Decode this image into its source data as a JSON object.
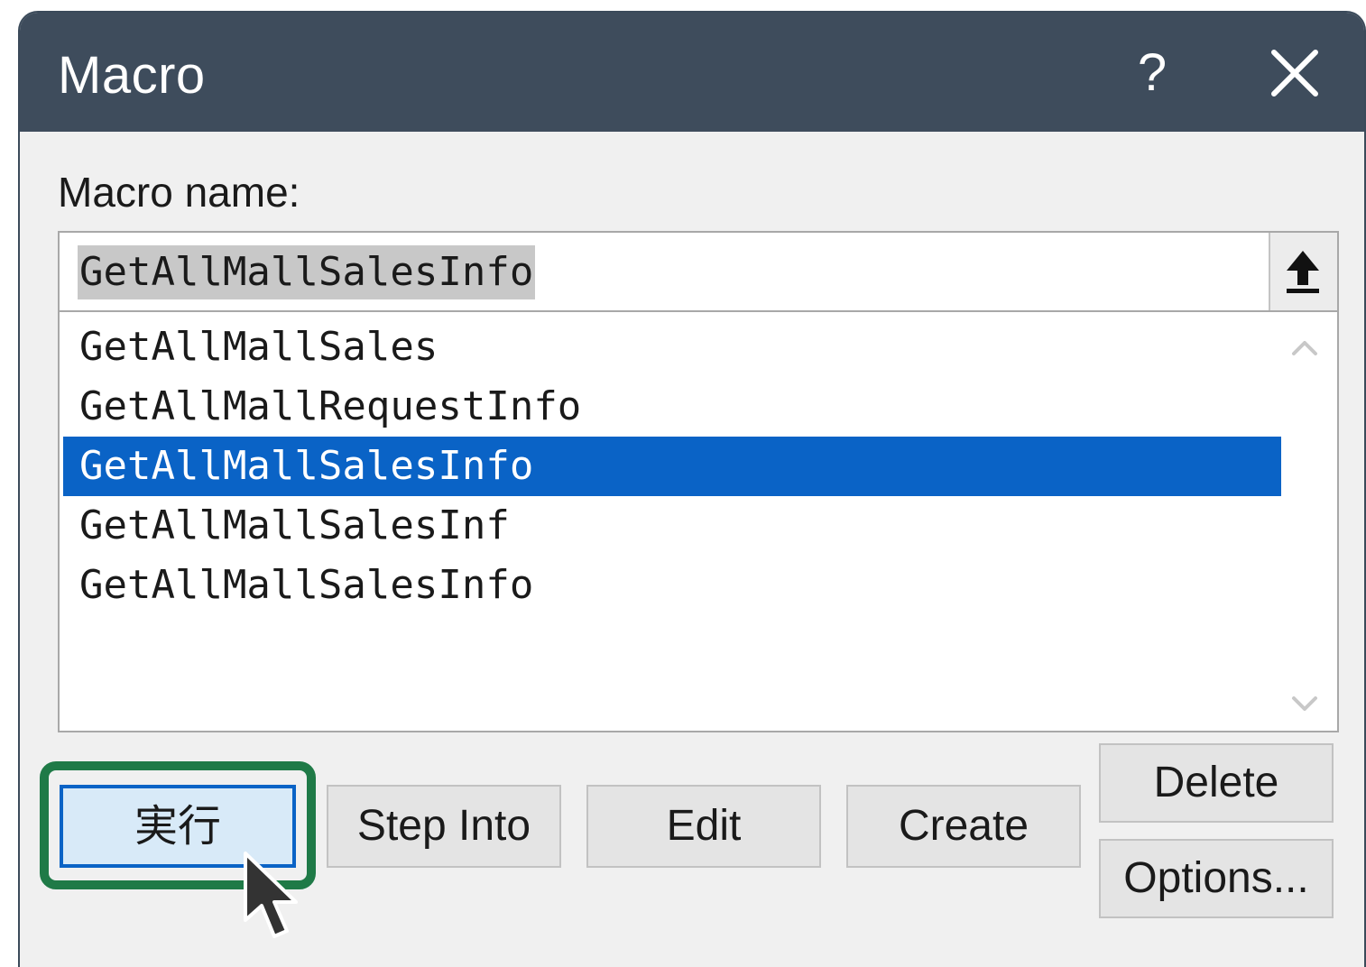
{
  "window": {
    "title": "Macro",
    "help_label": "?"
  },
  "form": {
    "name_label": "Macro name:",
    "name_value": "GetAllMallSalesInfo"
  },
  "macro_list": {
    "items": [
      {
        "label": "GetAllMallSales",
        "selected": false
      },
      {
        "label": "GetAllMallRequestInfo",
        "selected": false
      },
      {
        "label": "GetAllMallSalesInfo",
        "selected": true
      },
      {
        "label": "GetAllMallSalesInf",
        "selected": false
      },
      {
        "label": "GetAllMallSalesInfo",
        "selected": false
      }
    ]
  },
  "buttons": {
    "run": "実行",
    "step_into": "Step Into",
    "edit": "Edit",
    "create": "Create",
    "delete": "Delete",
    "options": "Options..."
  },
  "colors": {
    "titlebar": "#3e4c5c",
    "selection": "#0a63c6",
    "highlight_outline": "#1f7a47",
    "dialog_background": "#f0f0f0"
  },
  "icons": [
    "close-icon",
    "upload-arrow-icon",
    "scroll-up-icon",
    "scroll-down-icon",
    "mouse-pointer-icon"
  ]
}
